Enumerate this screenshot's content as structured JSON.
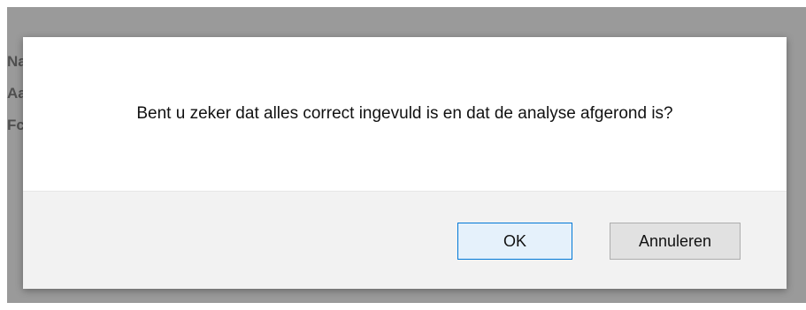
{
  "background_page": {
    "fragments": [
      "Na",
      "Aa",
      "Fc"
    ]
  },
  "dialog": {
    "message": "Bent u zeker dat alles correct ingevuld is en dat de analyse afgerond is?",
    "ok_label": "OK",
    "cancel_label": "Annuleren"
  },
  "colors": {
    "overlay": "#9a9a9a",
    "footer": "#f2f2f2",
    "ok_border": "#0078d7"
  }
}
